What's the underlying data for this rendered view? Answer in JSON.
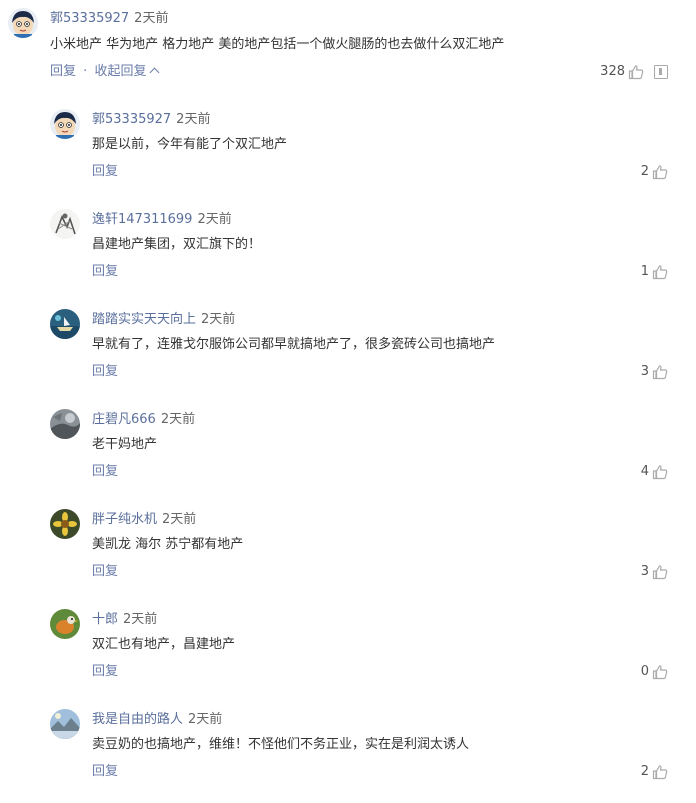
{
  "main_comment": {
    "user": "郭53335927",
    "time": "2天前",
    "content": "小米地产 华为地产 格力地产 美的地产包括一个做火腿肠的也去做什么双汇地产",
    "reply_label": "回复",
    "separator": "·",
    "collapse_label": "收起回复",
    "likes": "328",
    "avatar": "cartoon-avatar"
  },
  "replies": [
    {
      "user": "郭53335927",
      "time": "2天前",
      "content": "那是以前，今年有能了个双汇地产",
      "reply_label": "回复",
      "likes": "2",
      "avatar": "cartoon-avatar"
    },
    {
      "user": "逸轩147311699",
      "time": "2天前",
      "content": "昌建地产集团，双汇旗下的！",
      "reply_label": "回复",
      "likes": "1",
      "avatar": "sketch-avatar"
    },
    {
      "user": "踏踏实实天天向上",
      "time": "2天前",
      "content": "早就有了，连雅戈尔服饰公司都早就搞地产了，很多瓷砖公司也搞地产",
      "reply_label": "回复",
      "likes": "3",
      "avatar": "boat-avatar"
    },
    {
      "user": "庄碧凡666",
      "time": "2天前",
      "content": "老干妈地产",
      "reply_label": "回复",
      "likes": "4",
      "avatar": "photo-avatar"
    },
    {
      "user": "胖子纯水机",
      "time": "2天前",
      "content": "美凯龙 海尔 苏宁都有地产",
      "reply_label": "回复",
      "likes": "3",
      "avatar": "flower-avatar"
    },
    {
      "user": "十郎",
      "time": "2天前",
      "content": "双汇也有地产，昌建地产",
      "reply_label": "回复",
      "likes": "0",
      "avatar": "bird-avatar"
    },
    {
      "user": "我是自由的路人",
      "time": "2天前",
      "content": "卖豆奶的也搞地产，维维！不怪他们不务正业，实在是利润太诱人",
      "reply_label": "回复",
      "likes": "2",
      "avatar": "landscape-avatar"
    }
  ]
}
